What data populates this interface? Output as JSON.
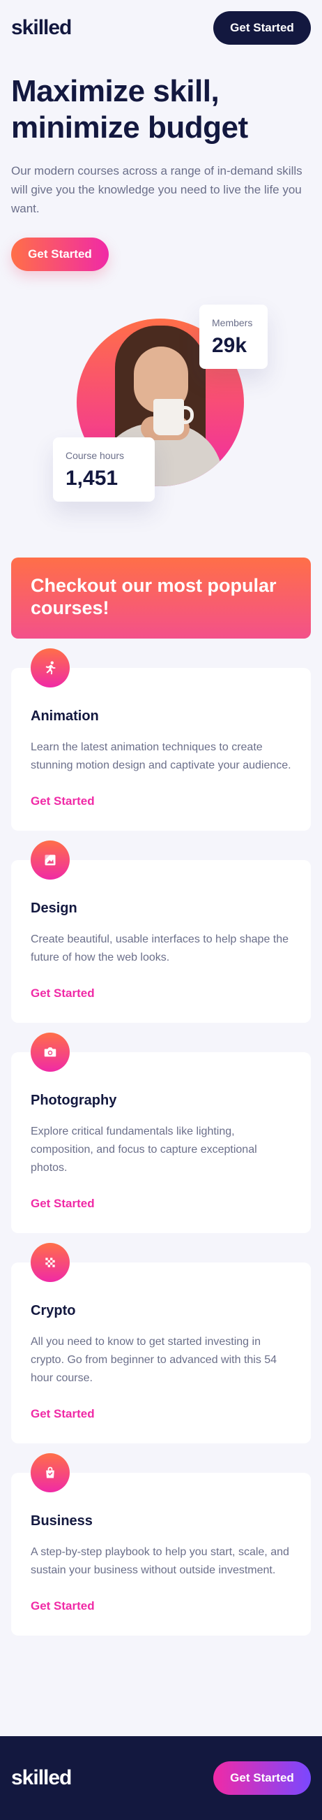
{
  "header": {
    "logo": "skilled",
    "cta_label": "Get Started"
  },
  "hero": {
    "title": "Maximize skill, minimize budget",
    "text": "Our modern courses across a range of in-demand skills will give you the knowledge you need to live the life you want.",
    "cta_label": "Get Started"
  },
  "stats": {
    "members": {
      "label": "Members",
      "value": "29k"
    },
    "hours": {
      "label": "Course hours",
      "value": "1,451"
    }
  },
  "courses": {
    "heading": "Checkout our most popular courses!",
    "items": [
      {
        "title": "Animation",
        "description": "Learn the latest animation techniques to create stunning motion design and captivate your audience.",
        "link": "Get Started",
        "icon": "running-figure-icon"
      },
      {
        "title": "Design",
        "description": "Create beautiful, usable interfaces to help shape the future of how the web looks.",
        "link": "Get Started",
        "icon": "design-image-icon"
      },
      {
        "title": "Photography",
        "description": "Explore critical fundamentals like lighting, composition, and focus to capture exceptional photos.",
        "link": "Get Started",
        "icon": "camera-icon"
      },
      {
        "title": "Crypto",
        "description": "All you need to know to get started investing in crypto. Go from beginner to advanced with this 54 hour course.",
        "link": "Get Started",
        "icon": "crypto-grid-icon"
      },
      {
        "title": "Business",
        "description": "A step-by-step playbook to help you start, scale, and sustain your business without outside investment.",
        "link": "Get Started",
        "icon": "shopping-bag-icon"
      }
    ]
  },
  "footer": {
    "logo": "skilled",
    "cta_label": "Get Started"
  },
  "colors": {
    "navy": "#13183f",
    "accent_orange": "#ff6f48",
    "accent_pink": "#f02aa6",
    "accent_purple": "#7a48ff"
  }
}
